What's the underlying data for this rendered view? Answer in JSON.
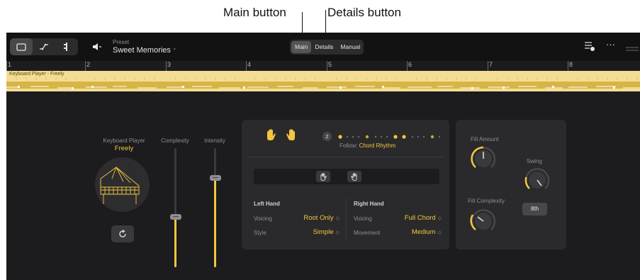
{
  "callouts": {
    "main": "Main button",
    "details": "Details button"
  },
  "toolbar": {
    "preset_caption": "Preset",
    "preset_name": "Sweet Memories",
    "tabs": [
      {
        "label": "Main",
        "active": true
      },
      {
        "label": "Details",
        "active": false
      },
      {
        "label": "Manual",
        "active": false
      }
    ],
    "more_label": "···"
  },
  "ruler": {
    "bars": [
      "1",
      "2",
      "3",
      "4",
      "5",
      "6",
      "7",
      "8"
    ]
  },
  "region": {
    "name": "Keyboard Player - Freely"
  },
  "player": {
    "caption": "Keyboard Player",
    "value": "Freely"
  },
  "sliders": {
    "complexity": {
      "label": "Complexity",
      "level": 0.42
    },
    "intensity": {
      "label": "Intensity",
      "level": 0.75
    }
  },
  "pattern": {
    "variation_count": "2",
    "follow_label": "Follow: ",
    "follow_value": "Chord Rhythm"
  },
  "left_hand": {
    "title": "Left Hand",
    "voicing_label": "Voicing",
    "voicing_value": "Root Only",
    "style_label": "Style",
    "style_value": "Simple"
  },
  "right_hand": {
    "title": "Right Hand",
    "voicing_label": "Voicing",
    "voicing_value": "Full Chord",
    "movement_label": "Movement",
    "movement_value": "Medium"
  },
  "fills": {
    "amount_label": "Fill Amount",
    "complexity_label": "Fill Complexity",
    "swing_label": "Swing",
    "swing_resolution": "8th"
  },
  "colors": {
    "accent": "#f2c640",
    "region": "#f3dd95",
    "background": "#1c1c1e"
  }
}
